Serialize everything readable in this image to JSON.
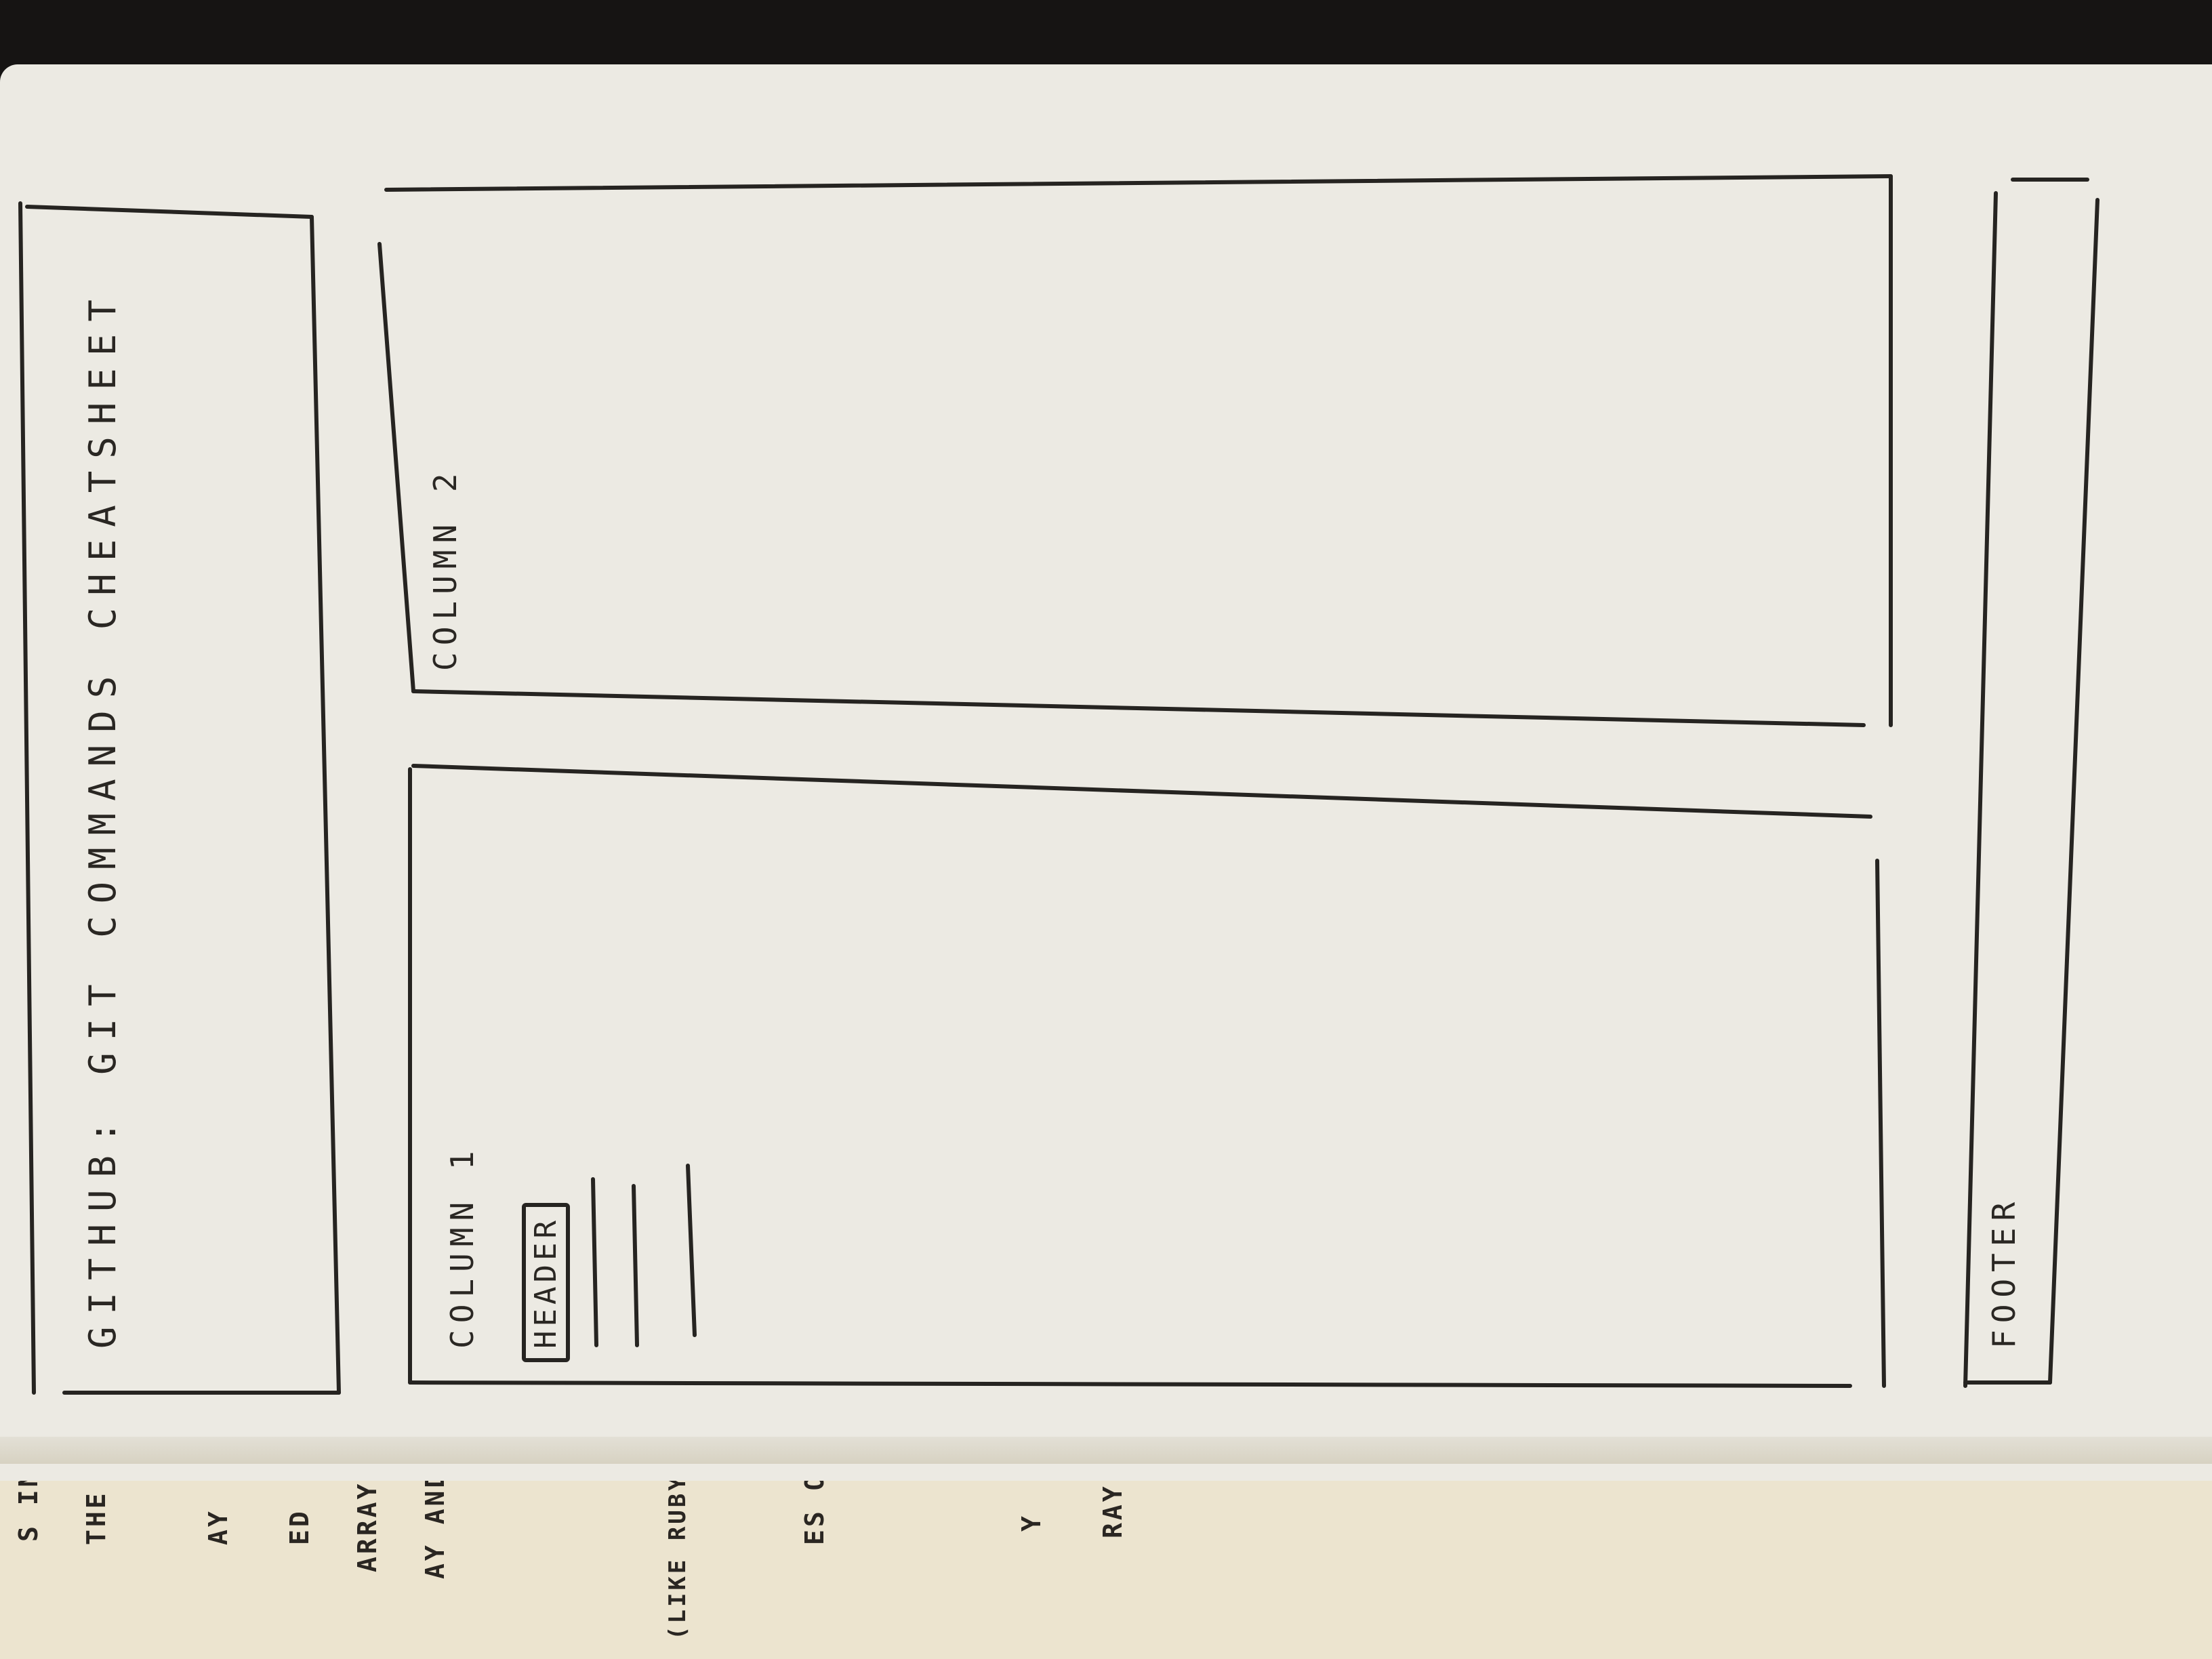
{
  "sketch": {
    "title": "GITHUB: GIT COMMANDS CHEATSHEET",
    "column1_label": "COLUMN 1",
    "column1_header": "HEADER",
    "column2_label": "COLUMN 2",
    "footer_label": "FOOTER"
  },
  "previous_page": {
    "lines": [
      "S INPUT",
      "THE",
      "AY",
      "ED",
      "ARRAY",
      "AY AND",
      "(LIKE RUBY)",
      "ES OF",
      "Y",
      "RAY"
    ]
  }
}
